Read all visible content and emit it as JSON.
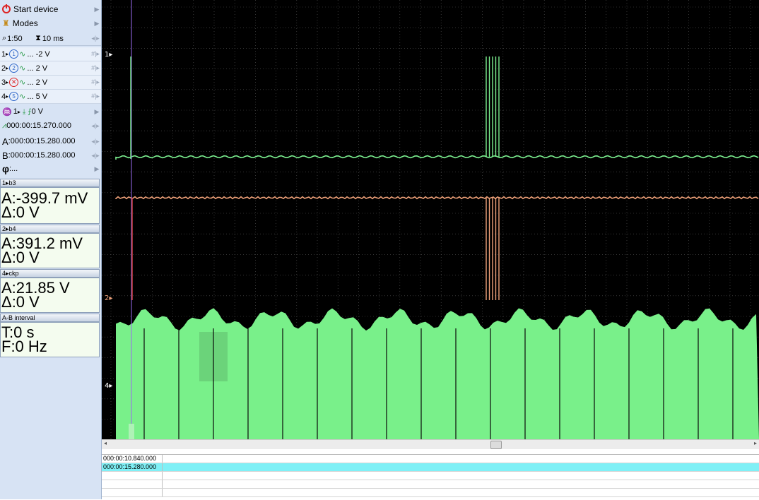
{
  "sidebar": {
    "start_device": "Start device",
    "modes": "Modes",
    "zoom_value": "1:50",
    "timebase_value": "10 ms",
    "channels": [
      {
        "num": "1",
        "badge": "1",
        "range": "... -2 V",
        "badge_color": "#2c64c8"
      },
      {
        "num": "2",
        "badge": "2",
        "range": "... 2 V",
        "badge_color": "#2c64c8"
      },
      {
        "num": "3",
        "badge": "",
        "range": "... 2 V",
        "badge_color": "#d22"
      },
      {
        "num": "4",
        "badge": "5",
        "range": "... 5 V",
        "badge_color": "#2c64c8"
      }
    ],
    "trigger_channel": "1",
    "trigger_level": "0 V",
    "trigger_time": "000:00:15.270.000",
    "cursor_a_label": "A",
    "cursor_a_time": ":000:00:15.280.000",
    "cursor_b_label": "B",
    "cursor_b_time": ":000:00:15.280.000",
    "phase_label": "φ",
    "phase_value": ":..."
  },
  "panels": [
    {
      "header": "1▸b3",
      "line1": "A:-399.7 mV",
      "line2": "Δ:0 V"
    },
    {
      "header": "2▸b4",
      "line1": "A:391.2 mV",
      "line2": "Δ:0 V"
    },
    {
      "header": "4▸ckp",
      "line1": "A:21.85 V",
      "line2": "Δ:0 V"
    },
    {
      "header": "A-B interval",
      "line1": "T:0 s",
      "line2": "F:0 Hz"
    }
  ],
  "scope": {
    "ch1_marker": "1",
    "ch2_marker": "2",
    "ch4_marker": "4",
    "colors": {
      "ch1": "#7cf090",
      "ch2": "#f0a27a",
      "ch4": "#79f08a",
      "grid": "#5a5a5a",
      "cursor": "#9a6cf0"
    }
  },
  "timestamps": [
    "000:00:10.840.000",
    "000:00:15.280.000"
  ]
}
